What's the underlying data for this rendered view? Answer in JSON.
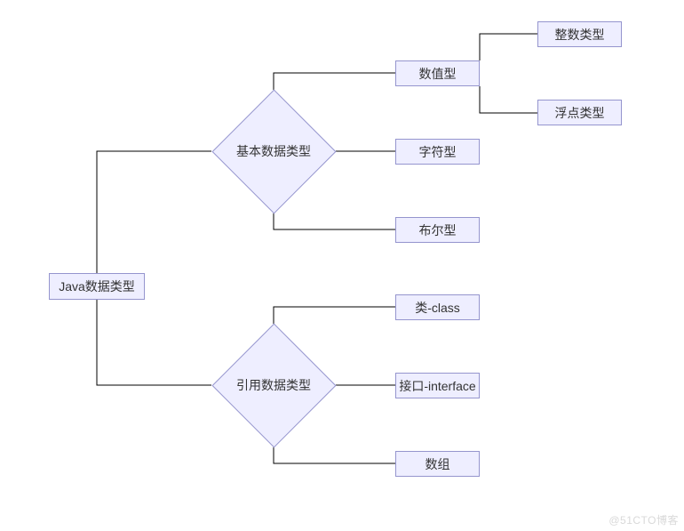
{
  "diagram": {
    "root": "Java数据类型",
    "basic": {
      "label": "基本数据类型",
      "numeric": {
        "label": "数值型",
        "integer": "整数类型",
        "float": "浮点类型"
      },
      "char": "字符型",
      "bool": "布尔型"
    },
    "reference": {
      "label": "引用数据类型",
      "class": "类-class",
      "interface": "接口-interface",
      "array": "数组"
    }
  },
  "watermark": "@51CTO博客",
  "colors": {
    "nodeFill": "#eeeeff",
    "nodeBorder": "#9595ce",
    "connector": "#000000"
  }
}
